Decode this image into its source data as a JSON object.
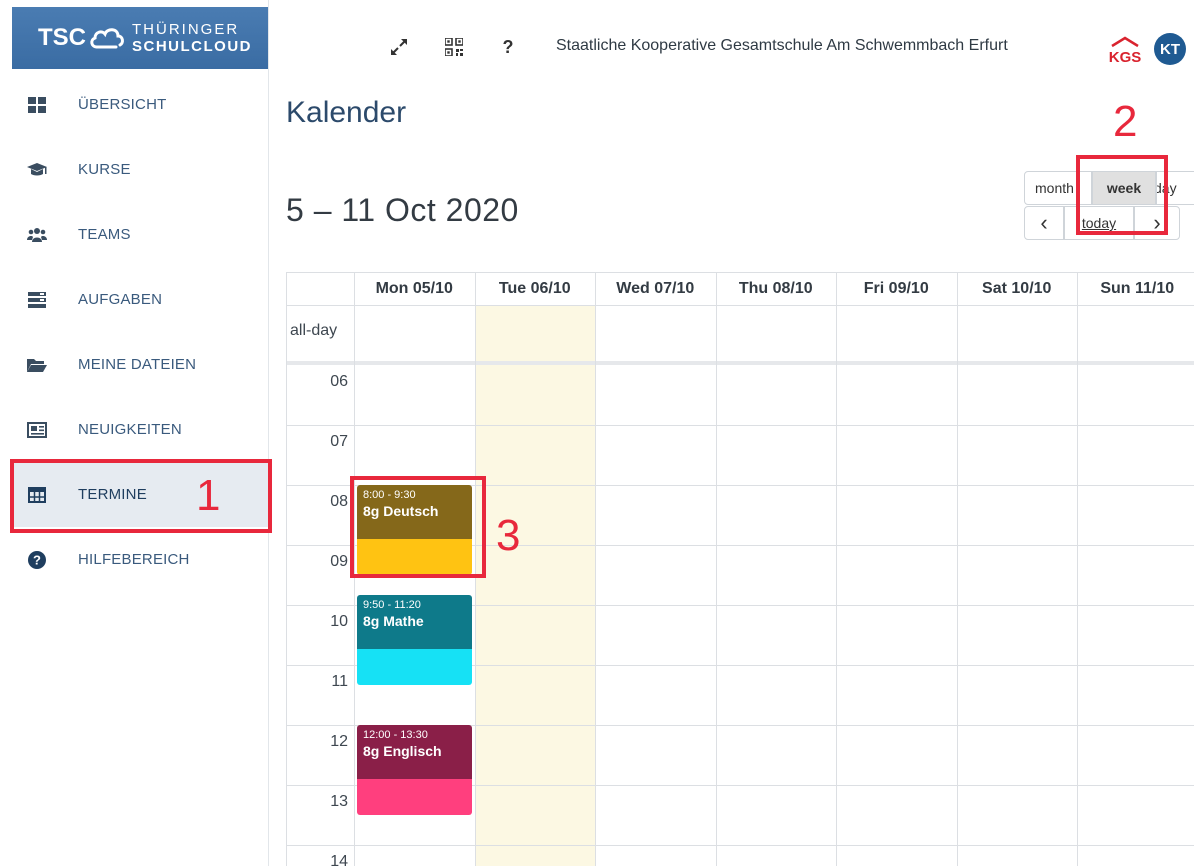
{
  "brand": {
    "short": "TSC",
    "line1": "THÜRINGER",
    "line2": "SCHULCLOUD",
    "color": "#4a7cb2"
  },
  "header": {
    "school_name": "Staatliche Kooperative Gesamtschule Am Schwemmbach Erfurt",
    "logo_text": "KGS",
    "avatar_initials": "KT",
    "icons": [
      "fullscreen-icon",
      "qr-code-icon",
      "help-icon"
    ]
  },
  "sidebar": {
    "items": [
      {
        "label": "ÜBERSICHT",
        "icon": "dashboard-icon"
      },
      {
        "label": "KURSE",
        "icon": "graduation-cap-icon"
      },
      {
        "label": "TEAMS",
        "icon": "users-icon"
      },
      {
        "label": "AUFGABEN",
        "icon": "tasks-icon"
      },
      {
        "label": "MEINE DATEIEN",
        "icon": "folder-icon"
      },
      {
        "label": "NEUIGKEITEN",
        "icon": "newspaper-icon"
      },
      {
        "label": "TERMINE",
        "icon": "calendar-table-icon",
        "active": true
      },
      {
        "label": "HILFEBEREICH",
        "icon": "question-circle-icon"
      }
    ]
  },
  "page": {
    "title": "Kalender",
    "range": "5 – 11 Oct 2020"
  },
  "views": {
    "month": "month",
    "week": "week",
    "day": "day",
    "selected": "week",
    "prev": "‹",
    "today": "today",
    "next": "›"
  },
  "calendar": {
    "days": [
      "Mon 05/10",
      "Tue 06/10",
      "Wed 07/10",
      "Thu 08/10",
      "Fri 09/10",
      "Sat 10/10",
      "Sun 11/10"
    ],
    "today_index": 1,
    "allday_label": "all-day",
    "hours": [
      "06",
      "07",
      "08",
      "09",
      "10",
      "11",
      "12",
      "13",
      "14"
    ],
    "events": [
      {
        "time": "8:00 - 9:30",
        "title": "8g Deutsch",
        "day": 0,
        "start": 8.0,
        "color_top": "#85681a",
        "color_bottom": "#ffc312"
      },
      {
        "time": "9:50 - 11:20",
        "title": "8g Mathe",
        "day": 0,
        "start": 9.83,
        "color_top": "#0e7a8a",
        "color_bottom": "#16e1f5"
      },
      {
        "time": "12:00 - 13:30",
        "title": "8g Englisch",
        "day": 0,
        "start": 12.0,
        "color_top": "#8a1f48",
        "color_bottom": "#ff3f7e"
      }
    ]
  },
  "annotations": {
    "n1": "1",
    "n2": "2",
    "n3": "3",
    "color": "#e8283c"
  }
}
